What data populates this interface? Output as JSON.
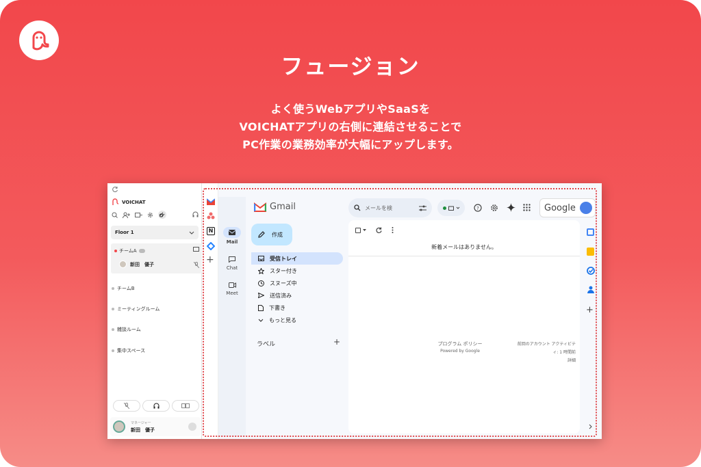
{
  "hero": {
    "title": "フュージョン",
    "desc1": "よく使うWebアプリやSaaSを",
    "desc2": "VOICHATアプリの右側に連結させることで",
    "desc3": "PC作業の業務効率が大幅にアップします。"
  },
  "colors": {
    "brand": "#f2474b",
    "gmail_selected": "#d3e3fd",
    "compose_bg": "#c2e7ff"
  },
  "voichat": {
    "app_name": "VOICHAT",
    "floor": "Floor 1",
    "teamA": "チームA",
    "member_name": "新田　優子",
    "rooms": [
      "チームB",
      "ミーティングルーム",
      "雑談ルーム",
      "集中スペース"
    ],
    "user_role": "マネージャー",
    "user_name": "新田　優子"
  },
  "gmail": {
    "logo_text": "Gmail",
    "search_placeholder": "メールを検",
    "google_text": "Google",
    "compose": "作成",
    "nav": [
      {
        "label": "Mail"
      },
      {
        "label": "Chat"
      },
      {
        "label": "Meet"
      }
    ],
    "folders": [
      "受信トレイ",
      "スター付き",
      "スヌーズ中",
      "送信済み",
      "下書き",
      "もっと見る"
    ],
    "labels_heading": "ラベル",
    "empty_message": "新着メールはありません。",
    "footer_policy": "プログラム ポリシー",
    "footer_powered": "Powered by Google",
    "footer_activity_1": "前回のアカウント アクティビテ",
    "footer_activity_2": "ィ: 1 時間前",
    "footer_details": "詳細"
  }
}
